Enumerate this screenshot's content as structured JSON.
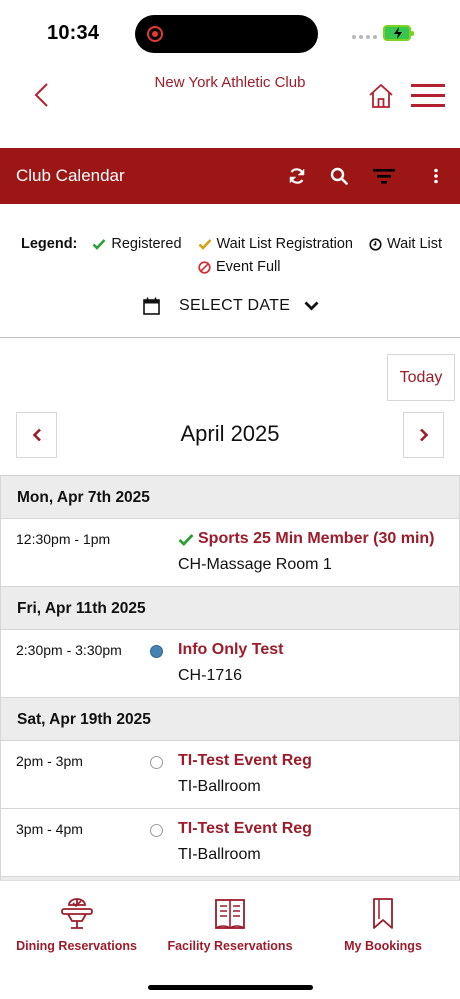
{
  "status_bar": {
    "time": "10:34"
  },
  "header": {
    "club_name": "New York Athletic Club"
  },
  "toolbar": {
    "title": "Club Calendar"
  },
  "legend": {
    "title": "Legend:",
    "items": [
      "Registered",
      "Wait List Registration",
      "Wait List",
      "Event Full"
    ]
  },
  "date_picker": {
    "label": "SELECT DATE"
  },
  "calendar": {
    "today_label": "Today",
    "month": "April 2025"
  },
  "days": [
    {
      "date": "Mon, Apr 7th 2025",
      "events": [
        {
          "time": "12:30pm - 1pm",
          "title": "Sports 25 Min Member (30 min)",
          "location": "CH-Massage Room 1",
          "status": "registered"
        }
      ]
    },
    {
      "date": "Fri, Apr 11th 2025",
      "events": [
        {
          "time": "2:30pm - 3:30pm",
          "title": "Info Only Test",
          "location": "CH-1716",
          "status": "info"
        }
      ]
    },
    {
      "date": "Sat, Apr 19th 2025",
      "events": [
        {
          "time": "2pm - 3pm",
          "title": "TI-Test Event Reg",
          "location": "TI-Ballroom",
          "status": "open"
        },
        {
          "time": "3pm - 4pm",
          "title": "TI-Test Event Reg",
          "location": "TI-Ballroom",
          "status": "open"
        }
      ]
    }
  ],
  "bottom_nav": {
    "dining": "Dining Reservations",
    "facility": "Facility Reservations",
    "bookings": "My Bookings"
  },
  "colors": {
    "brand_red": "#9d1616",
    "accent_red": "#9c1c2b",
    "registered_green": "#2e9e3a",
    "waitlist_gold": "#d4a017",
    "info_blue": "#4682b4"
  }
}
